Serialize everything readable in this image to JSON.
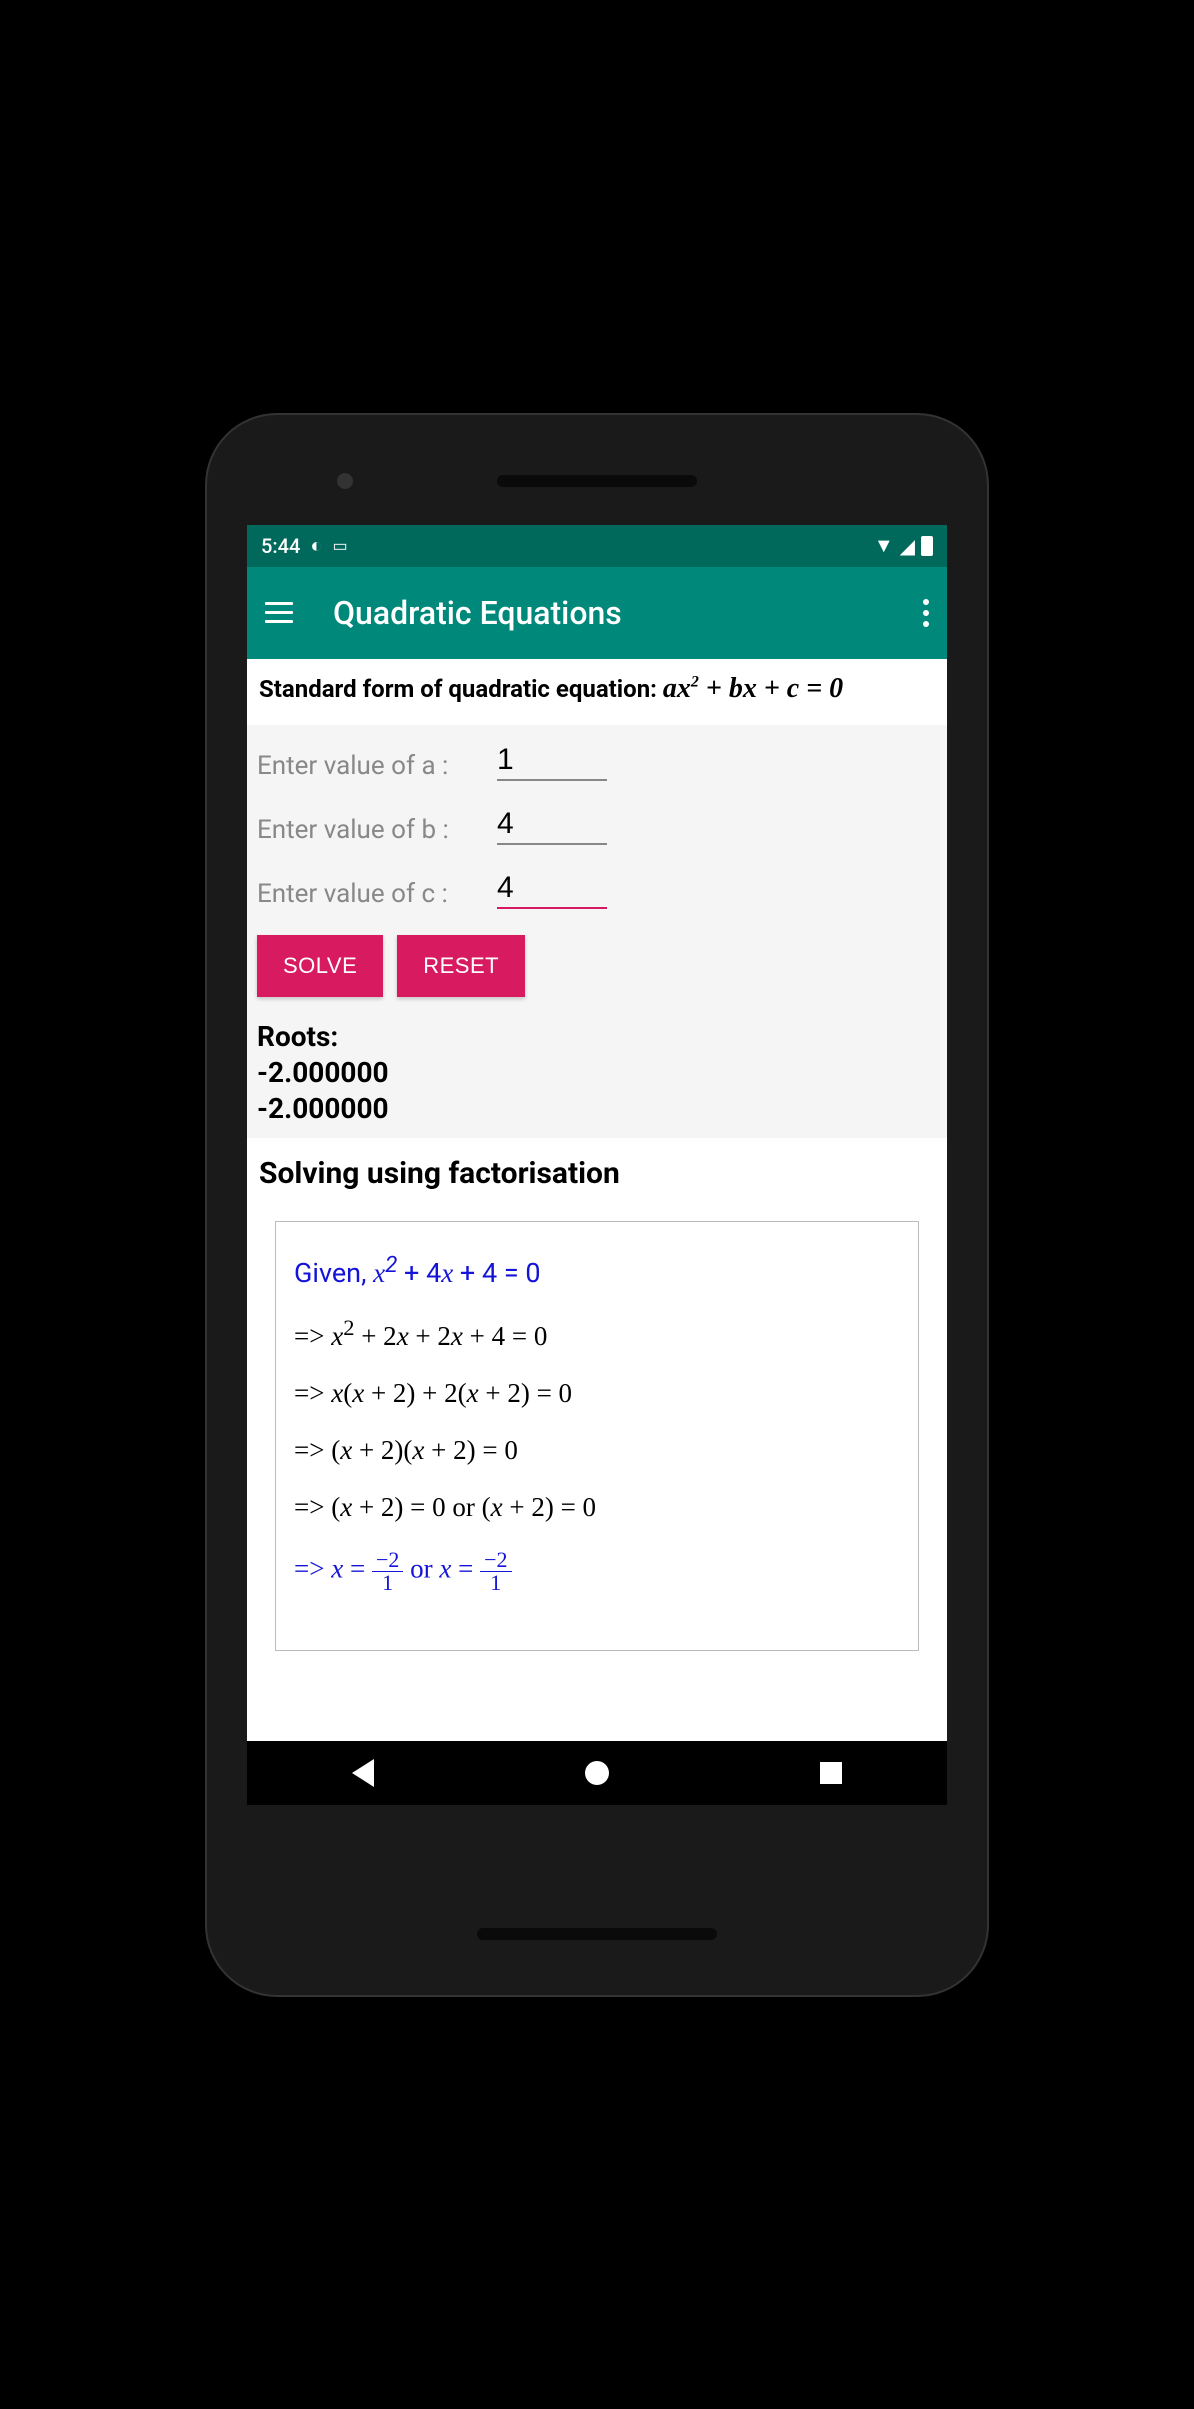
{
  "status": {
    "time": "5:44"
  },
  "appbar": {
    "title": "Quadratic Equations"
  },
  "header": {
    "label": "Standard form of quadratic equation: "
  },
  "inputs": {
    "a": {
      "label": "Enter value of a  :",
      "value": "1"
    },
    "b": {
      "label": "Enter value of b  :",
      "value": "4"
    },
    "c": {
      "label": "Enter value of c  :",
      "value": "4"
    }
  },
  "buttons": {
    "solve": "SOLVE",
    "reset": "RESET"
  },
  "roots": {
    "title": "Roots:",
    "r1": "-2.000000",
    "r2": "-2.000000"
  },
  "method": {
    "title": "Solving using factorisation"
  },
  "solution": {
    "given_prefix": "Given, ",
    "line2": "=> x² + 2x + 2x + 4 = 0",
    "line3": "=> x(x + 2) + 2(x + 2) = 0",
    "line4": "=> (x + 2)(x + 2) = 0",
    "line5": "=> (x + 2) = 0 or (x + 2) = 0",
    "frac": {
      "num": "−2",
      "den": "1"
    }
  }
}
